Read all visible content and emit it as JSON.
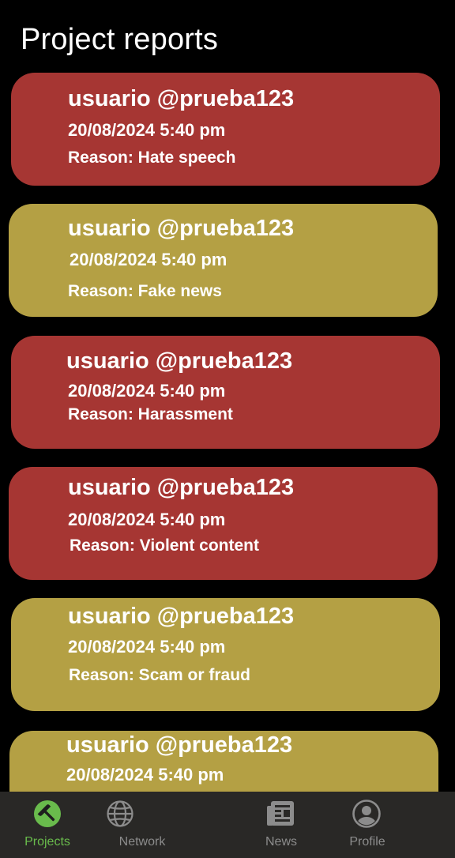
{
  "page": {
    "title": "Project reports"
  },
  "reports": [
    {
      "user": "usuario @prueba123",
      "datetime": "20/08/2024 5:40 pm",
      "reason": "Reason: Hate speech",
      "color": "#a63633"
    },
    {
      "user": "usuario @prueba123",
      "datetime": "20/08/2024 5:40 pm",
      "reason": "Reason: Fake news",
      "color": "#b4a044"
    },
    {
      "user": "usuario @prueba123",
      "datetime": "20/08/2024 5:40 pm",
      "reason": "Reason: Harassment",
      "color": "#a63633"
    },
    {
      "user": "usuario @prueba123",
      "datetime": "20/08/2024 5:40 pm",
      "reason": "Reason: Violent content",
      "color": "#a63633"
    },
    {
      "user": "usuario @prueba123",
      "datetime": "20/08/2024 5:40 pm",
      "reason": "Reason: Scam or fraud",
      "color": "#b4a044"
    },
    {
      "user": "usuario @prueba123",
      "datetime": "20/08/2024 5:40 pm",
      "reason": "",
      "color": "#b4a044"
    }
  ],
  "nav": {
    "items": [
      {
        "label": "Projects",
        "icon": "hammer-icon",
        "active": true
      },
      {
        "label": "Network",
        "icon": "globe-icon",
        "active": false
      },
      {
        "label": "News",
        "icon": "newspaper-icon",
        "active": false
      },
      {
        "label": "Profile",
        "icon": "user-circle-icon",
        "active": false
      }
    ]
  },
  "colors": {
    "background": "#000000",
    "report_red": "#a63633",
    "report_yellow": "#b4a044",
    "nav_background": "#292826",
    "nav_active": "#69bb4c",
    "nav_inactive": "#8c8c8c"
  }
}
